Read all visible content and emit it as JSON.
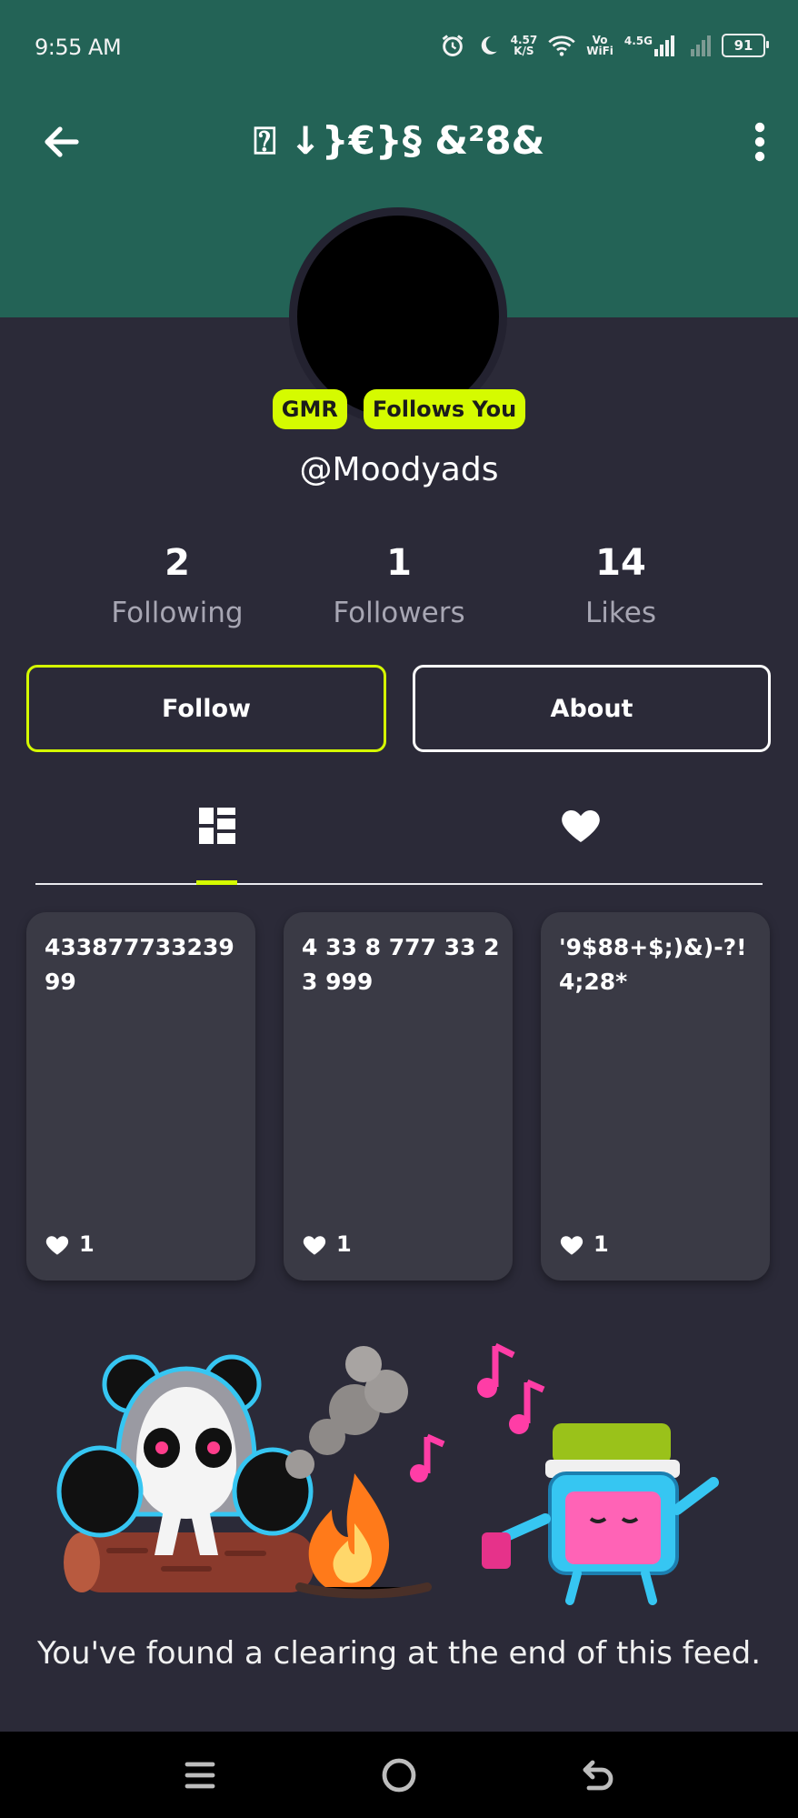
{
  "status_bar": {
    "time": "9:55 AM",
    "speed_value": "4.57",
    "speed_unit": "K/S",
    "vowifi_line1": "Vo",
    "vowifi_line2": "WiFi",
    "network": "4.5G",
    "battery": "91"
  },
  "header": {
    "title": "⍰ ↓}€}§ &²8&",
    "back_icon": "arrow-left",
    "menu_icon": "more-vertical"
  },
  "profile": {
    "badges": [
      "GMR",
      "Follows You"
    ],
    "username": "@Moodyads",
    "stats": [
      {
        "value": "2",
        "label": "Following"
      },
      {
        "value": "1",
        "label": "Followers"
      },
      {
        "value": "14",
        "label": "Likes"
      }
    ]
  },
  "actions": {
    "follow_label": "Follow",
    "about_label": "About"
  },
  "tabs": [
    {
      "icon": "grid-icon",
      "active": true
    },
    {
      "icon": "heart-icon",
      "active": false
    }
  ],
  "posts": [
    {
      "text": "433877733239 99",
      "likes": "1"
    },
    {
      "text": "4 33 8 777 33 2 3 999",
      "likes": "1"
    },
    {
      "text": "'9$88+$;)&)-?! 4;28*",
      "likes": "1"
    }
  ],
  "feed_end": {
    "message": "You've found a clearing at the end of this feed."
  },
  "colors": {
    "header_bg": "#236356",
    "page_bg": "#2b2a38",
    "accent": "#d5fb00",
    "card_bg": "#3a3a45"
  }
}
